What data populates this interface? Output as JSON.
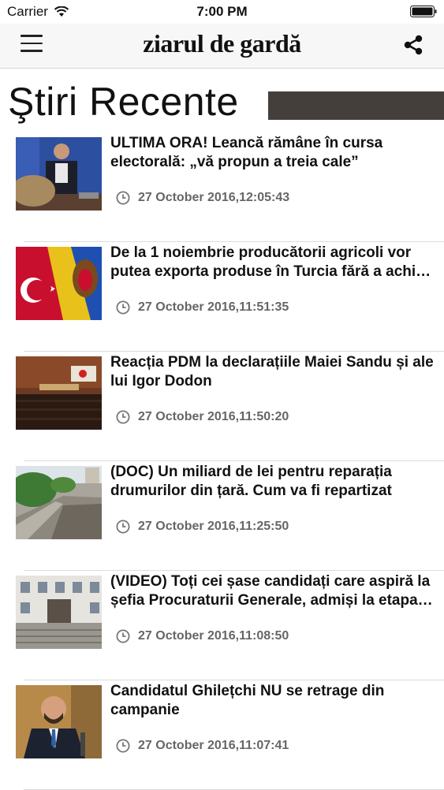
{
  "status": {
    "carrier": "Carrier",
    "time": "7:00 PM"
  },
  "nav": {
    "logo": "ziarul de gardă"
  },
  "section": {
    "title": "Ştiri Recente"
  },
  "news": [
    {
      "title": "ULTIMA ORA! Leancă rămâne în cursa electorală: „vă propun a treia cale”",
      "date": "27 October 2016,12:05:43"
    },
    {
      "title": "De la 1 noiembrie producătorii agricoli vor putea exporta produse în Turcia fără a achi…",
      "date": "27 October 2016,11:51:35"
    },
    {
      "title": "Reacția PDM la declarațiile Maiei Sandu și ale lui Igor Dodon",
      "date": "27 October 2016,11:50:20"
    },
    {
      "title": "(DOC) Un miliard de lei pentru reparația drumurilor din țară. Cum va fi repartizat",
      "date": "27 October 2016,11:25:50"
    },
    {
      "title": "(VIDEO) Toți cei șase candidați care aspiră la șefia Procuraturii Generale, admiși la etapa…",
      "date": "27 October 2016,11:08:50"
    },
    {
      "title": "Candidatul Ghilețchi NU se retrage din campanie",
      "date": "27 October 2016,11:07:41"
    }
  ],
  "colors": {
    "title_bar": "#453f3c",
    "date_text": "#666666",
    "nav_bg": "#f7f7f7"
  },
  "icons": [
    "wifi-icon",
    "battery-icon",
    "menu-icon",
    "share-icon",
    "clock-icon"
  ]
}
